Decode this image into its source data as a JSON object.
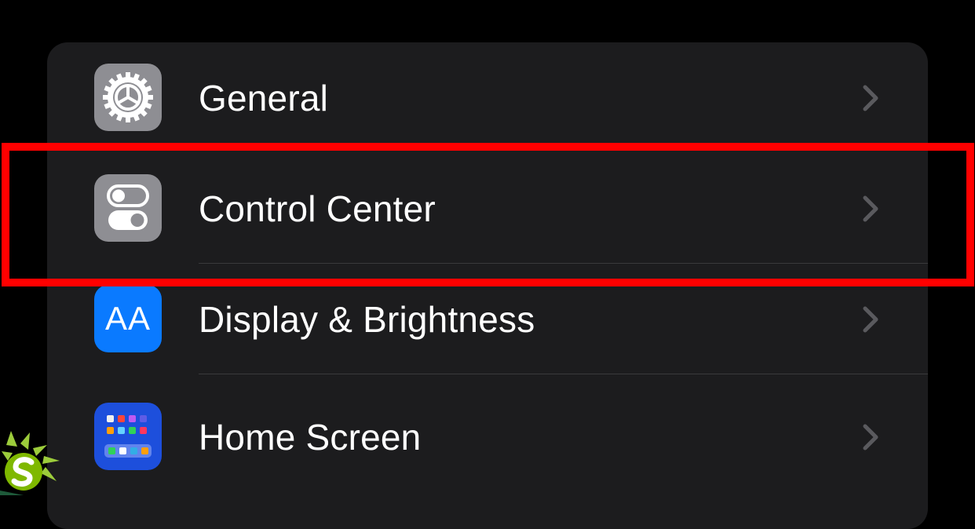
{
  "settings": {
    "rows": [
      {
        "label": "General",
        "icon": "gear-icon",
        "icon_bg": "#8e8e93"
      },
      {
        "label": "Control Center",
        "icon": "switches-icon",
        "icon_bg": "#8e8e93"
      },
      {
        "label": "Display & Brightness",
        "icon": "text-size-icon",
        "icon_glyph": "AA",
        "icon_bg": "#0a7aff"
      },
      {
        "label": "Home Screen",
        "icon": "app-grid-icon",
        "icon_bg": "#1d4fdc"
      }
    ]
  },
  "colors": {
    "background": "#000000",
    "group_background": "#1c1c1e",
    "separator": "#3a3a3c",
    "chevron": "#5a5a5e",
    "highlight": "#ff0000"
  }
}
